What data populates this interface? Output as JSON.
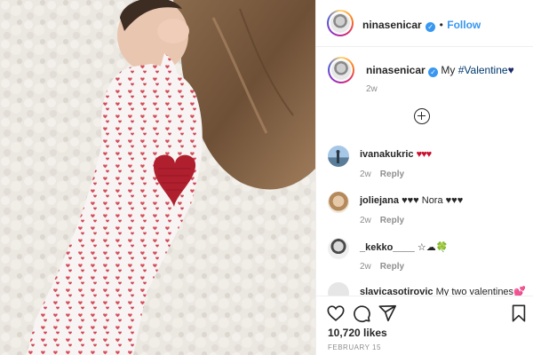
{
  "header": {
    "username": "ninasenicar",
    "verified_glyph": "✓",
    "separator": "•",
    "follow_label": "Follow"
  },
  "caption": {
    "username": "ninasenicar",
    "text_prefix": "My ",
    "hashtag": "#Valentine",
    "emoji": "♥",
    "time": "2w"
  },
  "load_more_icon": "plus-circle-icon",
  "comments": [
    {
      "username": "ivanakukric",
      "text": "♥♥♥",
      "text_color": "#c8102e",
      "time": "2w",
      "reply": "Reply"
    },
    {
      "username": "joliejana",
      "text": "♥♥♥ Nora ♥♥♥",
      "text_color": "#262626",
      "time": "2w",
      "reply": "Reply"
    },
    {
      "username": "_kekko____",
      "text": "☆☁🍀",
      "text_color": "#262626",
      "time": "2w",
      "reply": "Reply"
    },
    {
      "username": "slavicasotirovic",
      "text": "My two valentines💕",
      "text_color": "#262626",
      "time": "",
      "reply": ""
    }
  ],
  "actions": {
    "like_icon": "heart-outline-icon",
    "comment_icon": "comment-icon",
    "share_icon": "share-icon",
    "save_icon": "bookmark-icon"
  },
  "likes": "10,720 likes",
  "date": "FEBRUARY 15",
  "colors": {
    "link_blue": "#3897f0",
    "text": "#262626",
    "muted": "#8e8e8e",
    "hashtag": "#00376b",
    "heart_red": "#c8102e",
    "divider": "#efefef"
  }
}
